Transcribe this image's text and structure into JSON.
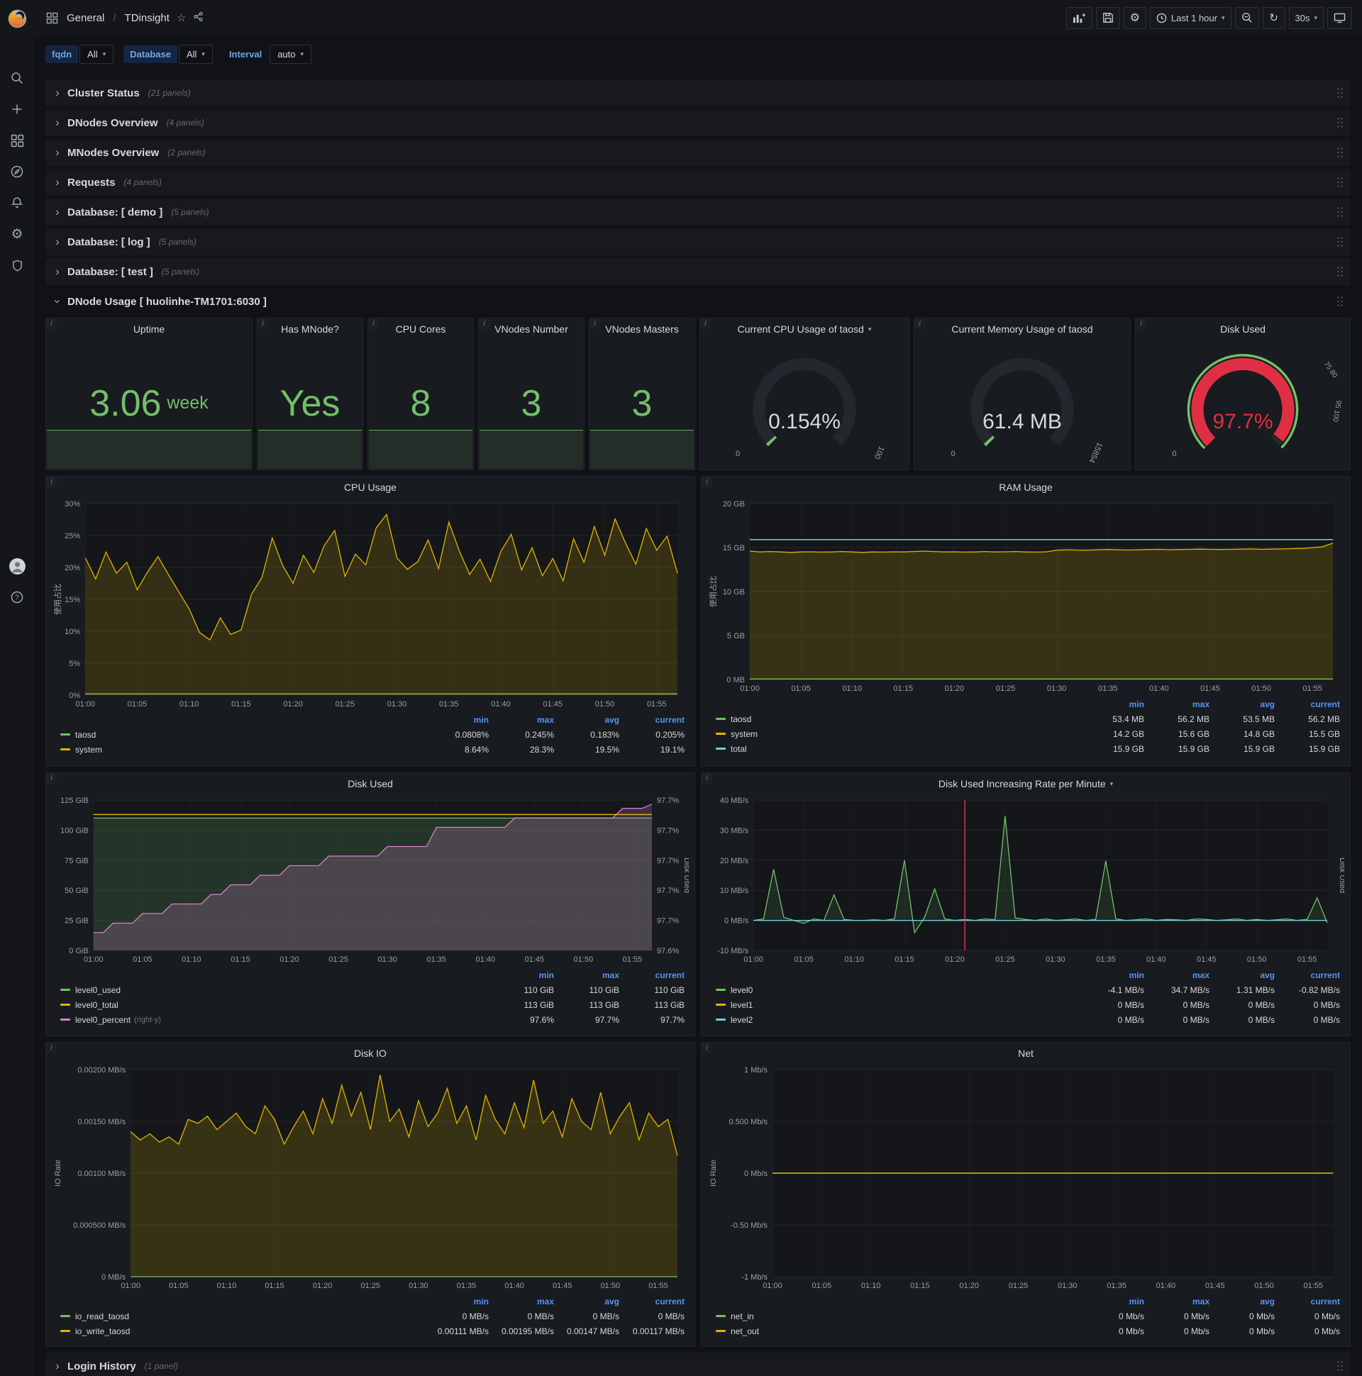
{
  "topbar": {
    "breadcrumb": {
      "section": "General",
      "separator": "/",
      "page": "TDinsight"
    },
    "time_range_label": "Last 1 hour",
    "refresh_value": "30s"
  },
  "variables": [
    {
      "label": "fqdn",
      "value": "All"
    },
    {
      "label": "Database",
      "value": "All"
    },
    {
      "label": "Interval",
      "value": "auto"
    }
  ],
  "collapsed_rows": [
    {
      "title": "Cluster Status",
      "count": "(21 panels)"
    },
    {
      "title": "DNodes Overview",
      "count": "(4 panels)"
    },
    {
      "title": "MNodes Overview",
      "count": "(2 panels)"
    },
    {
      "title": "Requests",
      "count": "(4 panels)"
    },
    {
      "title": "Database: [ demo ]",
      "count": "(5 panels)"
    },
    {
      "title": "Database: [ log ]",
      "count": "(5 panels)"
    },
    {
      "title": "Database: [ test ]",
      "count": "(5 panels)"
    }
  ],
  "expanded_row_title": "DNode Usage [ huolinhe-TM1701:6030 ]",
  "bottom_row": {
    "title": "Login History",
    "count": "(1 panel)"
  },
  "stats": [
    {
      "title": "Uptime",
      "value": "3.06",
      "unit": "week"
    },
    {
      "title": "Has MNode?",
      "value": "Yes",
      "unit": ""
    },
    {
      "title": "CPU Cores",
      "value": "8",
      "unit": ""
    },
    {
      "title": "VNodes Number",
      "value": "3",
      "unit": ""
    },
    {
      "title": "VNodes Masters",
      "value": "3",
      "unit": ""
    }
  ],
  "gauges": [
    {
      "title": "Current CPU Usage of taosd",
      "value": "0.154%",
      "percent": 0.154,
      "min_label": "0",
      "max_label": "100",
      "color": "#73bf69",
      "value_color": "#d8d9da"
    },
    {
      "title": "Current Memory Usage of taosd",
      "value": "61.4 MB",
      "percent": 0.39,
      "min_label": "0",
      "max_label": "15854",
      "color": "#73bf69",
      "value_color": "#d8d9da"
    },
    {
      "title": "Disk Used",
      "value": "97.7%",
      "percent": 97.7,
      "min_label": "0",
      "max_label": "",
      "color": "#e02f44",
      "value_color": "#e02f44",
      "outer_ring": "#73bf69",
      "threshold_labels": [
        "75 80",
        "95 100"
      ]
    }
  ],
  "charts_common": {
    "xticks": [
      "01:00",
      "01:05",
      "01:10",
      "01:15",
      "01:20",
      "01:25",
      "01:30",
      "01:35",
      "01:40",
      "01:45",
      "01:50",
      "01:55"
    ]
  },
  "charts": {
    "cpu": {
      "type": "line",
      "title": "CPU Usage",
      "ylabel": "使用占比",
      "ymin": 0,
      "ymax": 30,
      "yticks": [
        {
          "v": 0,
          "l": "0%"
        },
        {
          "v": 5,
          "l": "5%"
        },
        {
          "v": 10,
          "l": "10%"
        },
        {
          "v": 15,
          "l": "15%"
        },
        {
          "v": 20,
          "l": "20%"
        },
        {
          "v": 25,
          "l": "25%"
        },
        {
          "v": 30,
          "l": "30%"
        }
      ],
      "series": [
        {
          "name": "taosd",
          "color": "#73bf69",
          "flat": 0.2,
          "fill": true,
          "fo": 0.1
        },
        {
          "name": "system",
          "color": "#e0b400",
          "fill": true,
          "fo": 0.16,
          "values": [
            21.5,
            18.2,
            22.4,
            19.1,
            20.8,
            16.5,
            19.3,
            21.7,
            18.9,
            16.2,
            13.5,
            9.8,
            8.64,
            12.1,
            9.5,
            10.2,
            15.8,
            18.4,
            24.6,
            20.3,
            17.5,
            21.9,
            19.2,
            23.4,
            25.8,
            18.6,
            22.1,
            20.4,
            26.2,
            28.3,
            21.5,
            19.7,
            20.9,
            24.3,
            19.8,
            27.1,
            22.6,
            18.9,
            21.3,
            17.8,
            22.5,
            25.2,
            19.6,
            23.1,
            18.7,
            21.4,
            17.9,
            24.5,
            20.8,
            26.4,
            21.9,
            27.6,
            23.8,
            20.5,
            26.1,
            22.7,
            24.9,
            19.1
          ]
        }
      ],
      "legend": {
        "cols": [
          "min",
          "max",
          "avg",
          "current"
        ],
        "rows": [
          {
            "name": "taosd",
            "color": "#73bf69",
            "vals": [
              "0.0808%",
              "0.245%",
              "0.183%",
              "0.205%"
            ]
          },
          {
            "name": "system",
            "color": "#e0b400",
            "vals": [
              "8.64%",
              "28.3%",
              "19.5%",
              "19.1%"
            ]
          }
        ]
      }
    },
    "ram": {
      "type": "line",
      "title": "RAM Usage",
      "ylabel": "使用占比",
      "ymin": 0,
      "ymax": 20,
      "yticks": [
        {
          "v": 0,
          "l": "0 MB"
        },
        {
          "v": 5,
          "l": "5 GB"
        },
        {
          "v": 10,
          "l": "10 GB"
        },
        {
          "v": 15,
          "l": "15 GB"
        },
        {
          "v": 20,
          "l": "20 GB"
        }
      ],
      "series": [
        {
          "name": "taosd",
          "color": "#73bf69",
          "flat": 0.055,
          "fill": true,
          "fo": 0.12
        },
        {
          "name": "system",
          "color": "#e0b400",
          "fill": true,
          "fo": 0.18,
          "values": [
            14.6,
            14.5,
            14.55,
            14.5,
            14.45,
            14.5,
            14.52,
            14.48,
            14.5,
            14.55,
            14.5,
            14.45,
            14.5,
            14.48,
            14.52,
            14.5,
            14.55,
            14.6,
            14.55,
            14.5,
            14.52,
            14.48,
            14.5,
            14.55,
            14.5,
            14.52,
            14.55,
            14.5,
            14.48,
            14.52,
            14.7,
            14.75,
            14.72,
            14.7,
            14.75,
            14.78,
            14.75,
            14.72,
            14.75,
            14.78,
            14.8,
            14.75,
            14.78,
            14.8,
            14.82,
            14.8,
            14.78,
            14.8,
            14.82,
            14.85,
            14.8,
            14.82,
            14.85,
            14.88,
            14.9,
            15.0,
            15.1,
            15.5
          ]
        },
        {
          "name": "total",
          "color": "#6ed0e0",
          "flat": 15.9,
          "w": 1.5
        }
      ],
      "legend": {
        "cols": [
          "min",
          "max",
          "avg",
          "current"
        ],
        "rows": [
          {
            "name": "taosd",
            "color": "#73bf69",
            "vals": [
              "53.4 MB",
              "56.2 MB",
              "53.5 MB",
              "56.2 MB"
            ]
          },
          {
            "name": "system",
            "color": "#e0b400",
            "vals": [
              "14.2 GB",
              "15.6 GB",
              "14.8 GB",
              "15.5 GB"
            ]
          },
          {
            "name": "total",
            "color": "#6ed0e0",
            "vals": [
              "15.9 GB",
              "15.9 GB",
              "15.9 GB",
              "15.9 GB"
            ]
          }
        ]
      }
    },
    "disk_used": {
      "type": "line",
      "title": "Disk Used",
      "right_label": "Disk Used",
      "ymin": 0,
      "ymax": 125,
      "rymin": 97.595,
      "rymax": 97.705,
      "yticks": [
        {
          "v": 0,
          "l": "0 GiB"
        },
        {
          "v": 25,
          "l": "25 GiB"
        },
        {
          "v": 50,
          "l": "50 GiB"
        },
        {
          "v": 75,
          "l": "75 GiB"
        },
        {
          "v": 100,
          "l": "100 GiB"
        },
        {
          "v": 125,
          "l": "125 GiB"
        }
      ],
      "rticks": [
        "97.6%",
        "97.7%",
        "97.7%",
        "97.7%",
        "97.7%",
        "97.7%"
      ],
      "series": [
        {
          "name": "level0_used",
          "color": "#73bf69",
          "flat": 110,
          "fill": true,
          "fo": 0.18
        },
        {
          "name": "level0_total",
          "color": "#e0b400",
          "flat": 113,
          "w": 1.5
        },
        {
          "name": "level0_percent",
          "color": "#d683ce",
          "axis": "right",
          "fill": true,
          "fo": 0.22,
          "values": [
            97.608,
            97.608,
            97.615,
            97.615,
            97.615,
            97.622,
            97.622,
            97.622,
            97.629,
            97.629,
            97.629,
            97.629,
            97.636,
            97.636,
            97.643,
            97.643,
            97.643,
            97.65,
            97.65,
            97.65,
            97.657,
            97.657,
            97.657,
            97.657,
            97.664,
            97.664,
            97.664,
            97.664,
            97.664,
            97.664,
            97.671,
            97.671,
            97.671,
            97.671,
            97.671,
            97.685,
            97.685,
            97.685,
            97.685,
            97.685,
            97.685,
            97.685,
            97.685,
            97.692,
            97.692,
            97.692,
            97.692,
            97.692,
            97.692,
            97.692,
            97.692,
            97.692,
            97.692,
            97.692,
            97.699,
            97.699,
            97.699,
            97.702
          ]
        }
      ],
      "legend": {
        "cols": [
          "min",
          "max",
          "current"
        ],
        "rows": [
          {
            "name": "level0_used",
            "color": "#73bf69",
            "vals": [
              "110 GiB",
              "110 GiB",
              "110 GiB"
            ]
          },
          {
            "name": "level0_total",
            "color": "#e0b400",
            "vals": [
              "113 GiB",
              "113 GiB",
              "113 GiB"
            ]
          },
          {
            "name": "level0_percent",
            "suffix": "(right-y)",
            "color": "#d683ce",
            "vals": [
              "97.6%",
              "97.7%",
              "97.7%"
            ]
          }
        ]
      }
    },
    "disk_rate": {
      "type": "line",
      "title": "Disk Used Increasing Rate per Minute",
      "right_label": "Disk Used",
      "ymin": -10,
      "ymax": 40,
      "annotation_min": 21,
      "yticks": [
        {
          "v": -10,
          "l": "-10 MB/s"
        },
        {
          "v": 0,
          "l": "0 MB/s"
        },
        {
          "v": 10,
          "l": "10 MB/s"
        },
        {
          "v": 20,
          "l": "20 MB/s"
        },
        {
          "v": 30,
          "l": "30 MB/s"
        },
        {
          "v": 40,
          "l": "40 MB/s"
        }
      ],
      "series": [
        {
          "name": "level0",
          "color": "#73bf69",
          "fill": true,
          "fo": 0.12,
          "values": [
            0,
            0.5,
            17,
            1,
            0,
            -1,
            0.5,
            0,
            8.5,
            0.3,
            0,
            0,
            0.2,
            0,
            0.5,
            20,
            -4.1,
            1,
            10.5,
            0.5,
            0,
            0.3,
            0,
            0.5,
            0.2,
            34.7,
            0.8,
            0.3,
            0,
            0.5,
            0,
            0.2,
            0.5,
            0,
            0.3,
            19.8,
            0.5,
            0,
            0.2,
            0.5,
            0,
            0.3,
            0.2,
            0,
            0.5,
            0.3,
            0,
            0.2,
            0.5,
            0,
            0.3,
            0,
            0.2,
            0.5,
            0,
            0.3,
            7.5,
            -0.82
          ]
        },
        {
          "name": "level1",
          "color": "#e0b400",
          "flat": 0
        },
        {
          "name": "level2",
          "color": "#6ed0e0",
          "flat": 0
        }
      ],
      "legend": {
        "cols": [
          "min",
          "max",
          "avg",
          "current"
        ],
        "rows": [
          {
            "name": "level0",
            "color": "#73bf69",
            "vals": [
              "-4.1 MB/s",
              "34.7 MB/s",
              "1.31 MB/s",
              "-0.82 MB/s"
            ]
          },
          {
            "name": "level1",
            "color": "#e0b400",
            "vals": [
              "0 MB/s",
              "0 MB/s",
              "0 MB/s",
              "0 MB/s"
            ]
          },
          {
            "name": "level2",
            "color": "#6ed0e0",
            "vals": [
              "0 MB/s",
              "0 MB/s",
              "0 MB/s",
              "0 MB/s"
            ]
          }
        ]
      }
    },
    "disk_io": {
      "type": "line",
      "title": "Disk IO",
      "ylabel": "IO Rate",
      "ymin": 0,
      "ymax": 0.002,
      "yticks": [
        {
          "v": 0,
          "l": "0 MB/s"
        },
        {
          "v": 0.0005,
          "l": "0.000500 MB/s"
        },
        {
          "v": 0.001,
          "l": "0.00100 MB/s"
        },
        {
          "v": 0.0015,
          "l": "0.00150 MB/s"
        },
        {
          "v": 0.002,
          "l": "0.00200 MB/s"
        }
      ],
      "series": [
        {
          "name": "io_read_taosd",
          "color": "#73bf69",
          "flat": 0
        },
        {
          "name": "io_write_taosd",
          "color": "#e0b400",
          "fill": true,
          "fo": 0.18,
          "values": [
            0.0014,
            0.00132,
            0.00138,
            0.0013,
            0.00135,
            0.00128,
            0.00152,
            0.00148,
            0.00155,
            0.00142,
            0.0015,
            0.00158,
            0.00145,
            0.00138,
            0.00165,
            0.00152,
            0.00128,
            0.00145,
            0.0016,
            0.00138,
            0.00172,
            0.00148,
            0.00185,
            0.00155,
            0.00178,
            0.00142,
            0.00195,
            0.0015,
            0.00162,
            0.00135,
            0.0017,
            0.00145,
            0.00158,
            0.00182,
            0.00148,
            0.00165,
            0.00132,
            0.00175,
            0.00152,
            0.00138,
            0.00168,
            0.00144,
            0.0019,
            0.00148,
            0.0016,
            0.00135,
            0.00172,
            0.0015,
            0.00142,
            0.00178,
            0.00138,
            0.00155,
            0.00168,
            0.00132,
            0.00158,
            0.00145,
            0.00152,
            0.00117
          ]
        }
      ],
      "legend": {
        "cols": [
          "min",
          "max",
          "avg",
          "current"
        ],
        "rows": [
          {
            "name": "io_read_taosd",
            "color": "#73bf69",
            "vals": [
              "0 MB/s",
              "0 MB/s",
              "0 MB/s",
              "0 MB/s"
            ]
          },
          {
            "name": "io_write_taosd",
            "color": "#e0b400",
            "vals": [
              "0.00111 MB/s",
              "0.00195 MB/s",
              "0.00147 MB/s",
              "0.00117 MB/s"
            ]
          }
        ]
      }
    },
    "net": {
      "type": "line",
      "title": "Net",
      "ylabel": "IO Rate",
      "ymin": -1,
      "ymax": 1,
      "yticks": [
        {
          "v": -1,
          "l": "-1 Mb/s"
        },
        {
          "v": -0.5,
          "l": "-0.50 Mb/s"
        },
        {
          "v": 0,
          "l": "0 Mb/s"
        },
        {
          "v": 0.5,
          "l": "0.500 Mb/s"
        },
        {
          "v": 1,
          "l": "1 Mb/s"
        }
      ],
      "series": [
        {
          "name": "net_in",
          "color": "#73bf69",
          "flat": 0
        },
        {
          "name": "net_out",
          "color": "#e0b400",
          "flat": 0,
          "w": 1.4
        }
      ],
      "legend": {
        "cols": [
          "min",
          "max",
          "avg",
          "current"
        ],
        "rows": [
          {
            "name": "net_in",
            "color": "#73bf69",
            "vals": [
              "0 Mb/s",
              "0 Mb/s",
              "0 Mb/s",
              "0 Mb/s"
            ]
          },
          {
            "name": "net_out",
            "color": "#e0b400",
            "vals": [
              "0 Mb/s",
              "0 Mb/s",
              "0 Mb/s",
              "0 Mb/s"
            ]
          }
        ]
      }
    }
  },
  "palette": {
    "green": "#73bf69",
    "yellow": "#e0b400",
    "blue": "#5794f2",
    "cyan": "#6ed0e0",
    "pink": "#d683ce",
    "red": "#e02f44",
    "orange_brand": "#f05a28"
  }
}
